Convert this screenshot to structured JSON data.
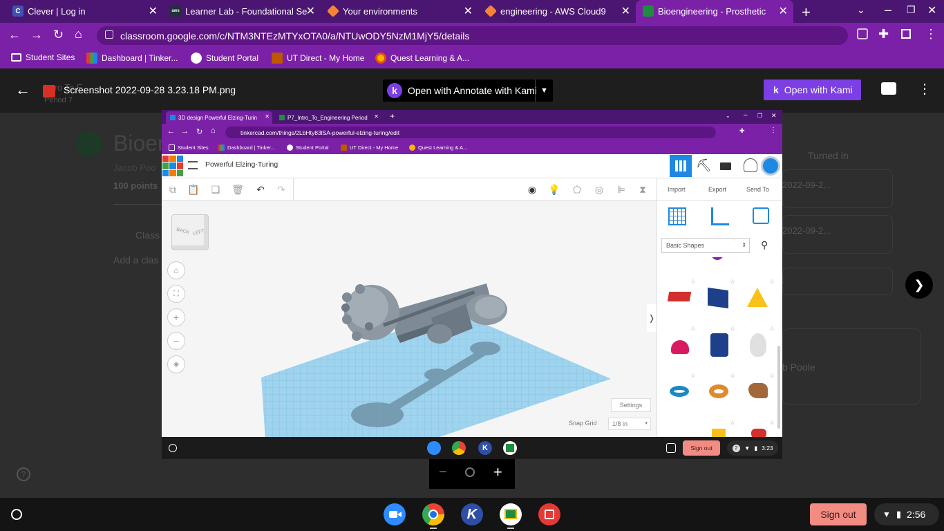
{
  "browser": {
    "tabs": [
      {
        "title": "Clever | Log in",
        "icon": "clever-icon",
        "color": "#3f51b5",
        "letter": "C"
      },
      {
        "title": "Learner Lab - Foundational Se",
        "icon": "aws-icon",
        "color": "#232f3e",
        "letter": "aws"
      },
      {
        "title": "Your environments",
        "icon": "cube-icon",
        "color": "#f58536",
        "letter": ""
      },
      {
        "title": "engineering - AWS Cloud9",
        "icon": "cube-icon",
        "color": "#f58536",
        "letter": ""
      },
      {
        "title": "Bioengineering - Prosthetic",
        "icon": "classroom-icon",
        "color": "#1e8e3e",
        "letter": "",
        "active": true
      }
    ],
    "address": "classroom.google.com/c/NTM3NTEzMTYxOTA0/a/NTUwODY5NzM1MjY5/details",
    "bookmarks": [
      {
        "label": "Student Sites",
        "icon": "folder-icon"
      },
      {
        "label": "Dashboard | Tinker...",
        "icon": "tinkercad-icon"
      },
      {
        "label": "Student Portal",
        "icon": "portal-icon"
      },
      {
        "label": "UT Direct - My Home",
        "icon": "ut-icon"
      },
      {
        "label": "Quest Learning & A...",
        "icon": "quest-icon"
      }
    ]
  },
  "viewer": {
    "filename": "Screenshot 2022-09-28 3.23.18 PM.png",
    "open_annotate": "Open with Annotate with Kami",
    "open_kami": "Open with Kami"
  },
  "classroom_bg": {
    "title_partial": "Bioen",
    "author_partial": "Jacob Poo",
    "points": "100 points",
    "class_comments": "Class",
    "add_comment": "Add a clas",
    "intro_partial": "Intro To E",
    "period": "Period 7",
    "turned_in": "Turned in",
    "date1": "2022-09-2...",
    "date2": "2022-09-2...",
    "right_partial": "t",
    "name_partial": "b Poole"
  },
  "screenshot": {
    "tabs": [
      "3D design Powerful Elzing-Turin",
      "P7_Intro_To_Engineering Period"
    ],
    "address": "tinkercad.com/things/2LbHty83lSA-powerful-elzing-turing/edit",
    "bookmarks": [
      "Student Sites",
      "Dashboard | Tinker...",
      "Student Portal",
      "UT Direct - My Home",
      "Quest Learning & A..."
    ],
    "design_name": "Powerful Elzing-Turing",
    "actions": [
      "Import",
      "Export",
      "Send To"
    ],
    "shape_category": "Basic Shapes",
    "settings": "Settings",
    "snap_grid_label": "Snap Grid",
    "snap_grid_value": "1/8 in",
    "view_cube": [
      "BACK",
      "LEFT"
    ],
    "sign_out": "Sign out",
    "time": "3:23",
    "notifications": "2"
  },
  "zoom": {
    "minus": "−",
    "plus": "+"
  },
  "shelf": {
    "sign_out": "Sign out",
    "time": "2:56"
  }
}
